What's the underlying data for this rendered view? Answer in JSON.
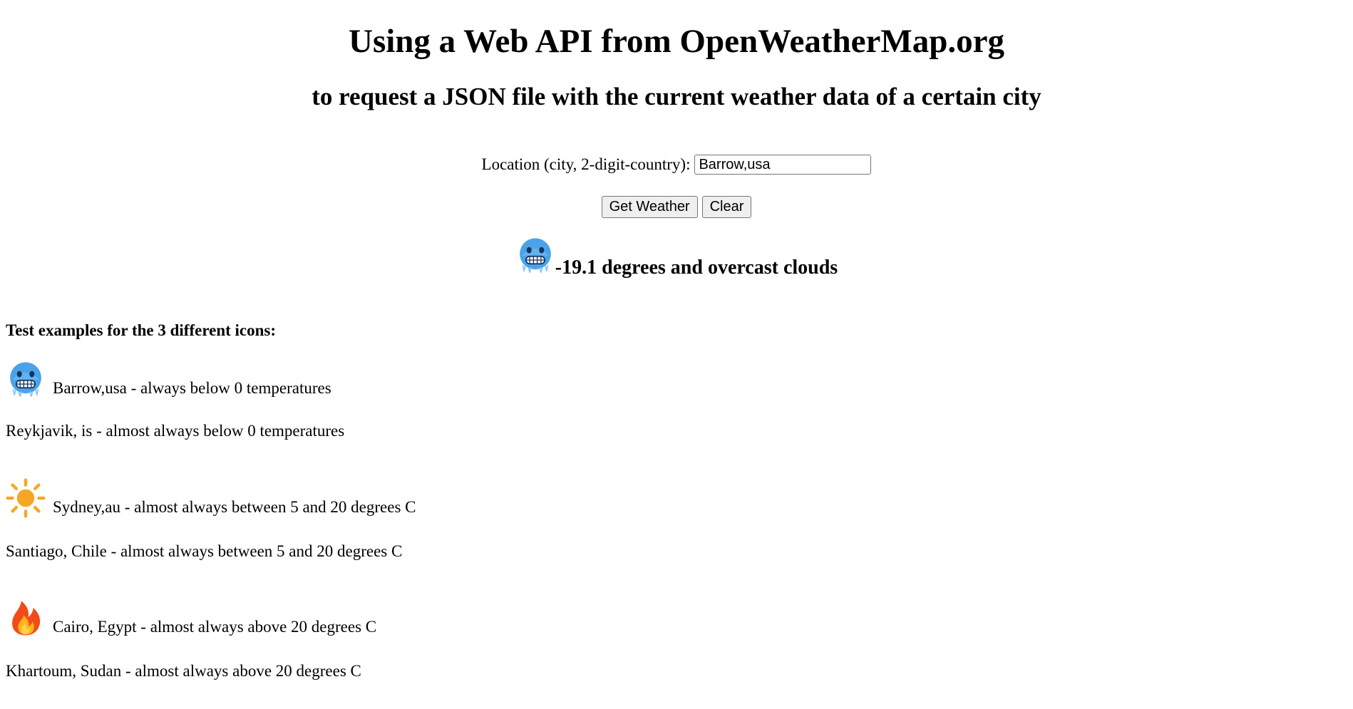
{
  "header": {
    "title": "Using a Web API from OpenWeatherMap.org",
    "subtitle": "to request a JSON file with the current weather data of a certain city"
  },
  "form": {
    "location_label": "Location (city, 2-digit-country):",
    "location_value": "Barrow,usa",
    "get_weather_label": "Get Weather",
    "clear_label": "Clear"
  },
  "result": {
    "icon": "cold-face-icon",
    "text": "-19.1 degrees and overcast clouds"
  },
  "examples": {
    "title": "Test examples for the 3 different icons:",
    "groups": [
      {
        "icon": "cold-face-icon",
        "first_line": "Barrow,usa - always below 0 temperatures",
        "second_line": "Reykjavik, is - almost always below 0 temperatures"
      },
      {
        "icon": "sun-icon",
        "first_line": "Sydney,au - almost always between 5 and 20 degrees C",
        "second_line": "Santiago, Chile - almost always between 5 and 20 degrees C"
      },
      {
        "icon": "fire-icon",
        "first_line": "Cairo, Egypt - almost always above 20 degrees C",
        "second_line": "Khartoum, Sudan - almost always above 20 degrees C"
      }
    ]
  },
  "colors": {
    "text": "#000000",
    "background": "#ffffff",
    "button_background": "#efefef",
    "input_border": "#767676",
    "cold_icon_face": "#4aa3e8",
    "sun_icon": "#f6a623",
    "fire_icon": "#f24b1a"
  }
}
